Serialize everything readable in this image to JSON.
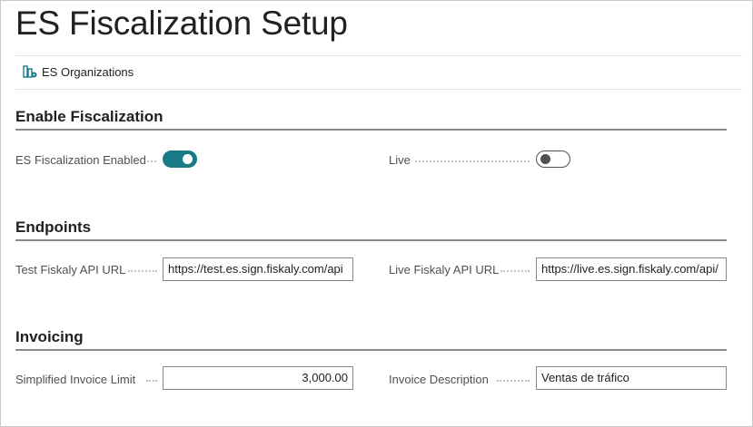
{
  "page": {
    "title": "ES Fiscalization Setup"
  },
  "actions": {
    "organizations_label": "ES Organizations",
    "organizations_icon": "organizations-icon"
  },
  "sections": {
    "enable": {
      "title": "Enable Fiscalization",
      "fiscalization_enabled_label": "ES Fiscalization Enabled",
      "fiscalization_enabled_value": true,
      "live_label": "Live",
      "live_value": false
    },
    "endpoints": {
      "title": "Endpoints",
      "test_api_label": "Test Fiskaly API URL",
      "test_api_value": "https://test.es.sign.fiskaly.com/api",
      "live_api_label": "Live Fiskaly API URL",
      "live_api_value": "https://live.es.sign.fiskaly.com/api/"
    },
    "invoicing": {
      "title": "Invoicing",
      "simplified_limit_label": "Simplified Invoice Limit",
      "simplified_limit_value": "3,000.00",
      "invoice_description_label": "Invoice Description",
      "invoice_description_value": "Ventas de tráfico"
    }
  },
  "colors": {
    "accent": "#197a87",
    "rule": "#8a8a8a",
    "text": "#212121",
    "label": "#505050"
  }
}
